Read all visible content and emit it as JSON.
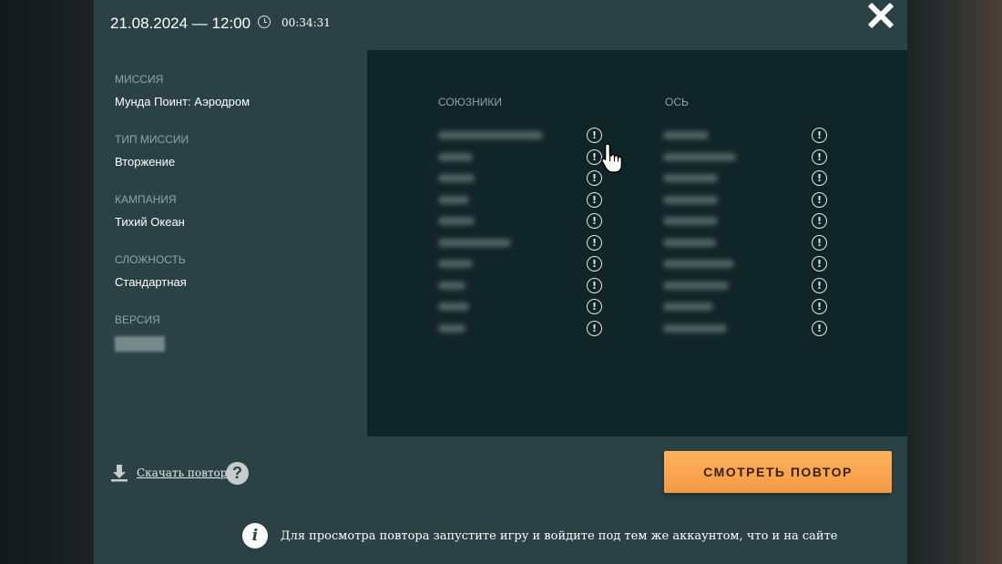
{
  "header": {
    "datetime": "21.08.2024 — 12:00",
    "duration": "00:34:31"
  },
  "info": [
    {
      "label": "МИССИЯ",
      "value": "Мунда Поинт: Аэродром"
    },
    {
      "label": "ТИП МИССИИ",
      "value": "Вторжение"
    },
    {
      "label": "КАМПАНИЯ",
      "value": "Тихий Океан"
    },
    {
      "label": "СЛОЖНОСТЬ",
      "value": "Стандартная"
    },
    {
      "label": "ВЕРСИЯ",
      "value": ""
    }
  ],
  "teams": {
    "allies_label": "СОЮЗНИКИ",
    "axis_label": "ОСЬ",
    "info_glyph": "!"
  },
  "footer": {
    "download_label": "Скачать повтор",
    "help_glyph": "?",
    "watch_label": "СМОТРЕТЬ ПОВТОР",
    "info_glyph": "i",
    "notice": "Для просмотра повтора запустите игру и войдите под тем же аккаунтом, что и на сайте"
  },
  "icons": {
    "close": "close-icon",
    "clock": "clock-icon",
    "download": "download-icon",
    "cursor": "hand-pointer-icon"
  }
}
